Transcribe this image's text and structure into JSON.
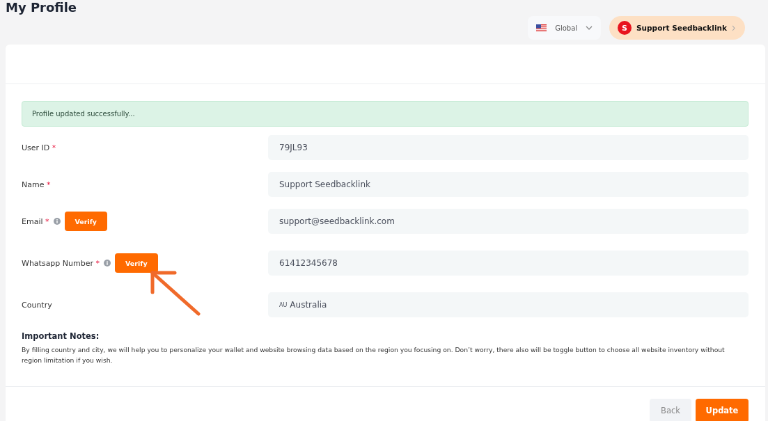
{
  "page_title": "My Profile",
  "region": {
    "label": "Global"
  },
  "user": {
    "initial": "S",
    "name": "Support Seedbacklink"
  },
  "alert": "Profile updated successfully...",
  "fields": [
    {
      "label": "User ID",
      "required_mark": "*",
      "info": false,
      "value": "79JL93"
    },
    {
      "label": "Name",
      "required_mark": "*",
      "info": false,
      "value": "Support Seedbacklink"
    },
    {
      "label": "Email",
      "required_mark": "*",
      "info": true,
      "verify": "Verify",
      "value": "support@seedbacklink.com"
    },
    {
      "label": "Whatsapp Number",
      "required_mark": "*",
      "info": true,
      "verify": "Verify",
      "value": "61412345678"
    },
    {
      "label": "Country",
      "info": false,
      "code": "AU",
      "value": "Australia"
    }
  ],
  "notes": {
    "title": "Important Notes:",
    "text": "By filling country and city, we will help you to personalize your wallet and website browsing data based on the region you focusing on. Don’t worry, there also will be toggle button to choose all website inventory without region limitation if you wish."
  },
  "buttons": [
    {
      "label": "Back",
      "kind": "secondary"
    },
    {
      "label": "Update",
      "kind": "primary"
    }
  ]
}
